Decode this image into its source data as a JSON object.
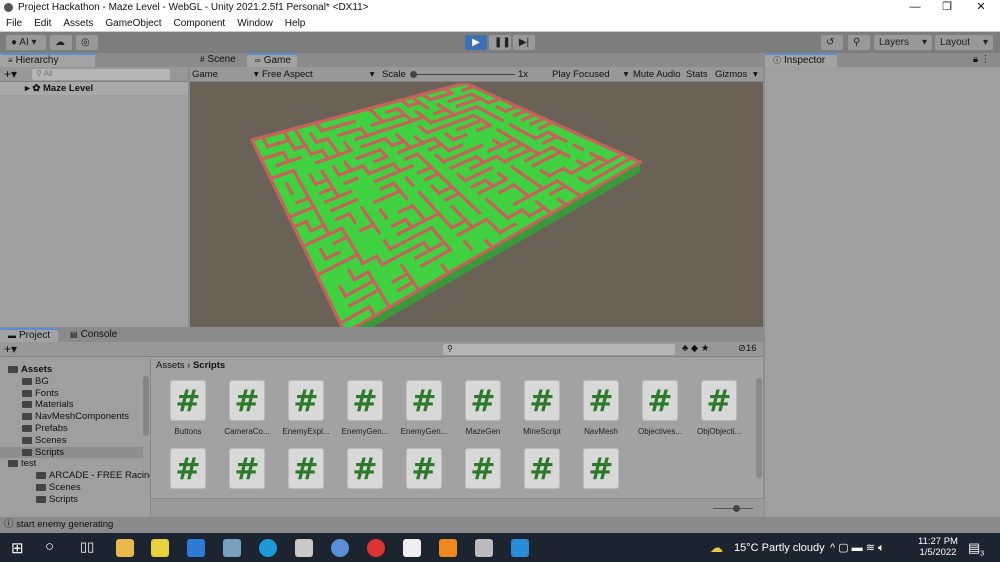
{
  "window": {
    "title": "Project Hackathon - Maze Level - WebGL - Unity 2021.2.5f1 Personal* <DX11>"
  },
  "menu": [
    "File",
    "Edit",
    "Assets",
    "GameObject",
    "Component",
    "Window",
    "Help"
  ],
  "toolbar": {
    "account": "AI",
    "layers": "Layers",
    "layout": "Layout"
  },
  "hierarchy": {
    "tab": "Hierarchy",
    "search_placeholder": "All",
    "root": "Maze Level"
  },
  "game": {
    "tabs": [
      "Scene",
      "Game"
    ],
    "display": "Game",
    "aspect": "Free Aspect",
    "scale_label": "Scale",
    "scale_value": "1x",
    "play_mode": "Play Focused",
    "mute": "Mute Audio",
    "stats": "Stats",
    "gizmos": "Gizmos"
  },
  "inspector": {
    "tab": "Inspector"
  },
  "project": {
    "tabs": [
      "Project",
      "Console"
    ],
    "breadcrumb": [
      "Assets",
      "Scripts"
    ],
    "hidden_count": "16",
    "tree": [
      {
        "label": "Assets",
        "depth": 0,
        "bold": true
      },
      {
        "label": "BG",
        "depth": 1
      },
      {
        "label": "Fonts",
        "depth": 1
      },
      {
        "label": "Materials",
        "depth": 1
      },
      {
        "label": "NavMeshComponents",
        "depth": 1
      },
      {
        "label": "Prefabs",
        "depth": 1
      },
      {
        "label": "Scenes",
        "depth": 1
      },
      {
        "label": "Scripts",
        "depth": 1,
        "selected": true
      },
      {
        "label": "test",
        "depth": 0
      },
      {
        "label": "ARCADE - FREE Racing",
        "depth": 2
      },
      {
        "label": "Scenes",
        "depth": 2
      },
      {
        "label": "Scripts",
        "depth": 2
      }
    ],
    "assets": [
      "Buttons",
      "CameraCo...",
      "EnemyExpl...",
      "EnemyGen...",
      "EnemyGen...",
      "MazeGen",
      "MineScript",
      "NavMesh",
      "Objectives...",
      "ObjObjecti..."
    ],
    "assets_row2_count": 8
  },
  "status": {
    "message": "start enemy generating"
  },
  "taskbar": {
    "weather_temp": "15°C",
    "weather_text": "Partly cloudy",
    "time": "11:27 PM",
    "date": "1/5/2022",
    "notifications": "3"
  },
  "colors": {
    "maze_floor": "#3fd13f",
    "maze_wall": "#c8605c",
    "accent": "#3f6fb4"
  }
}
